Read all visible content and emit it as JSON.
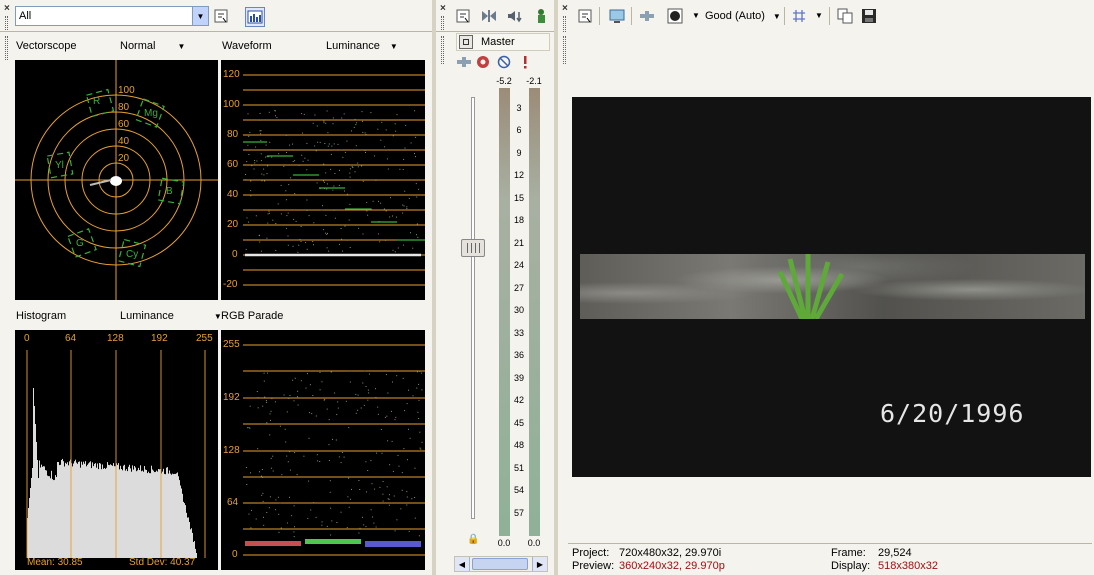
{
  "scopes_panel": {
    "filter_value": "All",
    "vectorscope": {
      "title": "Vectorscope",
      "mode": "Normal",
      "rings": [
        "100",
        "80",
        "60",
        "40",
        "20"
      ],
      "targets": [
        "R",
        "Mg",
        "Yl",
        "B",
        "G",
        "Cy"
      ]
    },
    "waveform": {
      "title": "Waveform",
      "mode": "Luminance",
      "ticks": [
        "120",
        "100",
        "80",
        "60",
        "40",
        "20",
        "0",
        "-20"
      ]
    },
    "histogram": {
      "title": "Histogram",
      "mode": "Luminance",
      "ticks": [
        "0",
        "64",
        "128",
        "192",
        "255"
      ],
      "mean": "Mean: 30.85",
      "std_dev": "Std Dev: 40.37"
    },
    "rgb_parade": {
      "title": "RGB Parade",
      "ticks": [
        "255",
        "192",
        "128",
        "64",
        "0"
      ]
    }
  },
  "mixer": {
    "title": "Master",
    "left_peak": "-5.2",
    "right_peak": "-2.1",
    "scale": [
      "3",
      "6",
      "9",
      "12",
      "15",
      "18",
      "21",
      "24",
      "27",
      "30",
      "33",
      "36",
      "39",
      "42",
      "45",
      "48",
      "51",
      "54",
      "57"
    ],
    "left_level": "0.0",
    "right_level": "0.0"
  },
  "preview": {
    "quality": "Good (Auto)",
    "timestamp": "6/20/1996",
    "project_label": "Project:",
    "project_value": "720x480x32, 29.970i",
    "preview_label": "Preview:",
    "preview_value": "360x240x32, 29.970p",
    "frame_label": "Frame:",
    "frame_value": "29,524",
    "display_label": "Display:",
    "display_value": "518x380x32"
  },
  "colors": {
    "accent_orange": "#e8a030",
    "trace_green": "#3ab03a",
    "value_red": "#a01010"
  }
}
